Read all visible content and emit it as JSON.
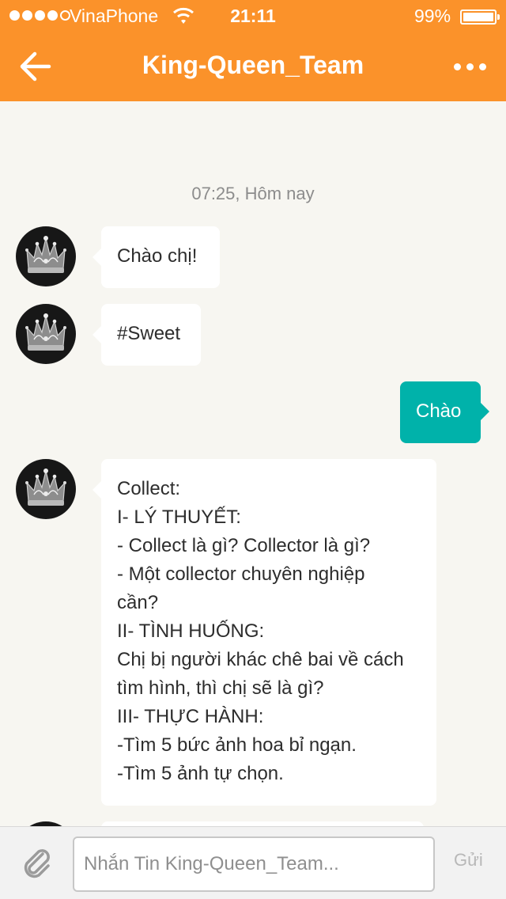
{
  "status_bar": {
    "carrier": "VinaPhone",
    "time": "21:11",
    "battery": "99%",
    "battery_level": 0.99,
    "signal_strength": 4
  },
  "header": {
    "title": "King-Queen_Team",
    "back_icon": "arrow-left-icon",
    "more_icon": "more-dots-icon"
  },
  "chat": {
    "timestamp": "07:25, Hôm nay",
    "messages": [
      {
        "direction": "in",
        "text": "Chào chị!"
      },
      {
        "direction": "in",
        "text": "#Sweet"
      },
      {
        "direction": "out",
        "text": "Chào"
      },
      {
        "direction": "in",
        "lines": [
          "Collect:",
          "I- LÝ THUYẾT:",
          "- Collect là gì? Collector là gì?",
          "- Một collector chuyên nghiệp",
          "cần?",
          "II- TÌNH HUỐNG:",
          "Chị bị người khác chê bai về cách",
          "tìm hình, thì chị sẽ là gì?",
          "III- THỰC HÀNH:",
          "-Tìm 5 bức ảnh hoa bỉ ngạn.",
          "-Tìm 5 ảnh tự chọn."
        ]
      }
    ]
  },
  "composer": {
    "placeholder": "Nhắn Tin King-Queen_Team...",
    "value": "",
    "send_label": "Gửi",
    "attach_icon": "paperclip-icon"
  },
  "colors": {
    "header": "#fb922a",
    "outgoing_bubble": "#00b2aa",
    "background": "#f7f6f1"
  }
}
